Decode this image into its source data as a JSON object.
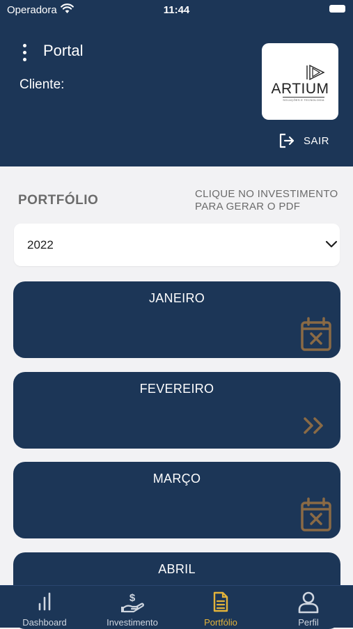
{
  "status_bar": {
    "carrier": "Operadora",
    "time": "11:44"
  },
  "header": {
    "title": "Portal",
    "client_label": "Cliente:",
    "logo": {
      "wordmark": "ARTIUM",
      "tagline": "SOLUÇÕES E TECNOLOGIA"
    },
    "logout_label": "SAIR"
  },
  "portfolio": {
    "section_title": "PORTFÓLIO",
    "hint": "CLIQUE NO INVESTIMENTO PARA GERAR O PDF",
    "year_select": {
      "value": "2022"
    },
    "months": [
      {
        "name": "JANEIRO",
        "icon": "calendar-x-icon"
      },
      {
        "name": "FEVEREIRO",
        "icon": "double-chevron-right-icon"
      },
      {
        "name": "MARÇO",
        "icon": "calendar-x-icon"
      },
      {
        "name": "ABRIL",
        "icon": "calendar-x-icon"
      }
    ]
  },
  "tabs": [
    {
      "label": "Dashboard",
      "icon": "bar-chart-icon",
      "active": false
    },
    {
      "label": "Investimento",
      "icon": "hand-dollar-icon",
      "active": false
    },
    {
      "label": "Portfólio",
      "icon": "document-icon",
      "active": true
    },
    {
      "label": "Perfil",
      "icon": "user-icon",
      "active": false
    }
  ],
  "colors": {
    "primary": "#1c3657",
    "background": "#f2f2f4",
    "accent": "#e3b33a",
    "card_icon": "#8a6a45",
    "muted_text": "#6b6b6b"
  }
}
